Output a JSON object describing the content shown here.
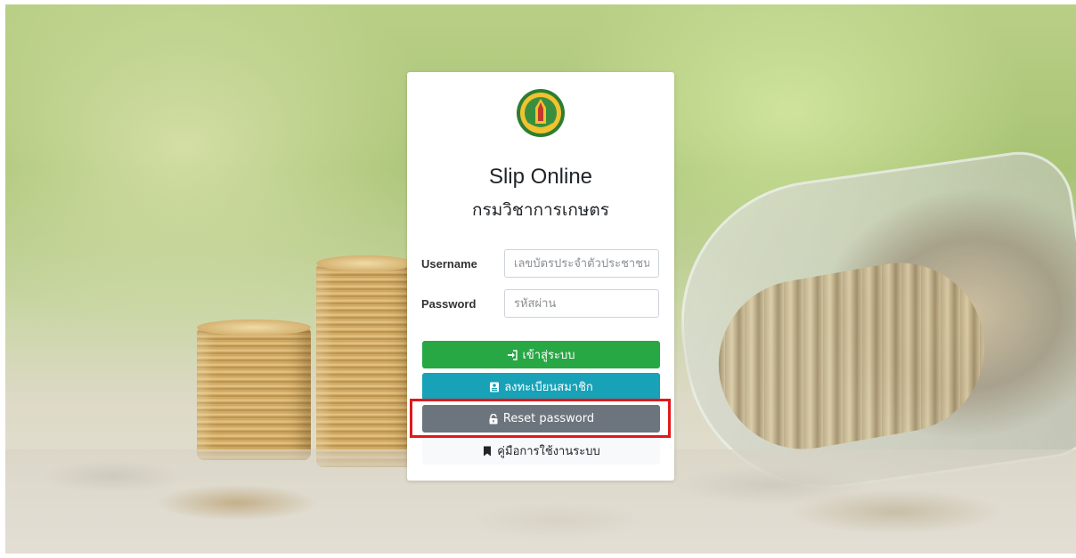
{
  "app": {
    "title": "Slip Online",
    "subtitle": "กรมวิชาการเกษตร"
  },
  "form": {
    "username_label": "Username",
    "username_placeholder": "เลขบัตรประจำตัวประชาชน",
    "password_label": "Password",
    "password_placeholder": "รหัสผ่าน"
  },
  "buttons": {
    "login": {
      "label": "เข้าสู่ระบบ",
      "icon": "sign-in-icon",
      "color": "#28a745"
    },
    "register": {
      "label": "ลงทะเบียนสมาชิก",
      "icon": "id-card-icon",
      "color": "#17a2b8"
    },
    "reset": {
      "label": "Reset password",
      "icon": "unlock-icon",
      "color": "#6c757d"
    },
    "manual": {
      "label": "คู่มือการใช้งานระบบ",
      "icon": "bookmark-icon",
      "color": "#f8f9fa"
    }
  },
  "highlight_color": "#e0191c"
}
